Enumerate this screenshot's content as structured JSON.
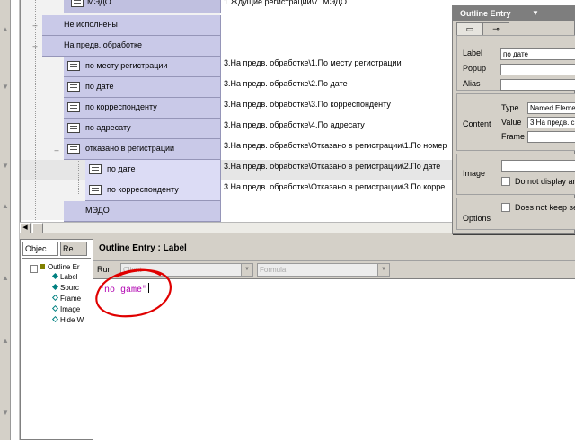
{
  "outline": {
    "rows": [
      {
        "label": "МЭДО",
        "path": "1.Ждущие регистрации\\7. МЭДО"
      },
      {
        "label": "Не исполнены",
        "path": ""
      },
      {
        "label": "На предв. обработке",
        "path": ""
      },
      {
        "label": "по месту регистрации",
        "path": "3.На предв. обработке\\1.По месту регистрации"
      },
      {
        "label": "по дате",
        "path": "3.На предв. обработке\\2.По дате"
      },
      {
        "label": "по корреспонденту",
        "path": "3.На предв. обработке\\3.По корреспонденту"
      },
      {
        "label": "по адресату",
        "path": "3.На предв. обработке\\4.По адресату"
      },
      {
        "label": "отказано в регистрации",
        "path": "3.На предв. обработке\\Отказано в регистрации\\1.По номер"
      },
      {
        "label": "по дате",
        "path": "3.На предв. обработке\\Отказано в регистрации\\2.По дате"
      },
      {
        "label": "по корреспонденту",
        "path": "3.На предв. обработке\\Отказано в регистрации\\3.По корре"
      },
      {
        "label": "МЭДО",
        "path": ""
      }
    ]
  },
  "props": {
    "title": "Outline Entry",
    "title_arrow": "▼",
    "label_label": "Label",
    "label_value": "по дате",
    "popup_label": "Popup",
    "alias_label": "Alias",
    "content_label": "Content",
    "type_label": "Type",
    "type_value": "Named Eleme",
    "value_label": "Value",
    "value_value": "3.На предв. с",
    "frame_label": "Frame",
    "image_label": "Image",
    "not_display_label": "Do not display an",
    "options_label": "Options",
    "not_keep_label": "Does not keep se"
  },
  "objects": {
    "tab1": "Objec...",
    "tab2": "Re...",
    "root": "Outline Er",
    "items": [
      "Label",
      "Sourc",
      "Frame",
      "Image",
      "Hide W"
    ]
  },
  "editor": {
    "title": "Outline Entry : Label",
    "run_label": "Run",
    "client_placeholder": "Client",
    "formula_placeholder": "Formula",
    "code": "\"no game\""
  },
  "colors": {
    "node": "#c9c9e8",
    "formula_text": "#b000b0",
    "annotation": "#e00000"
  }
}
